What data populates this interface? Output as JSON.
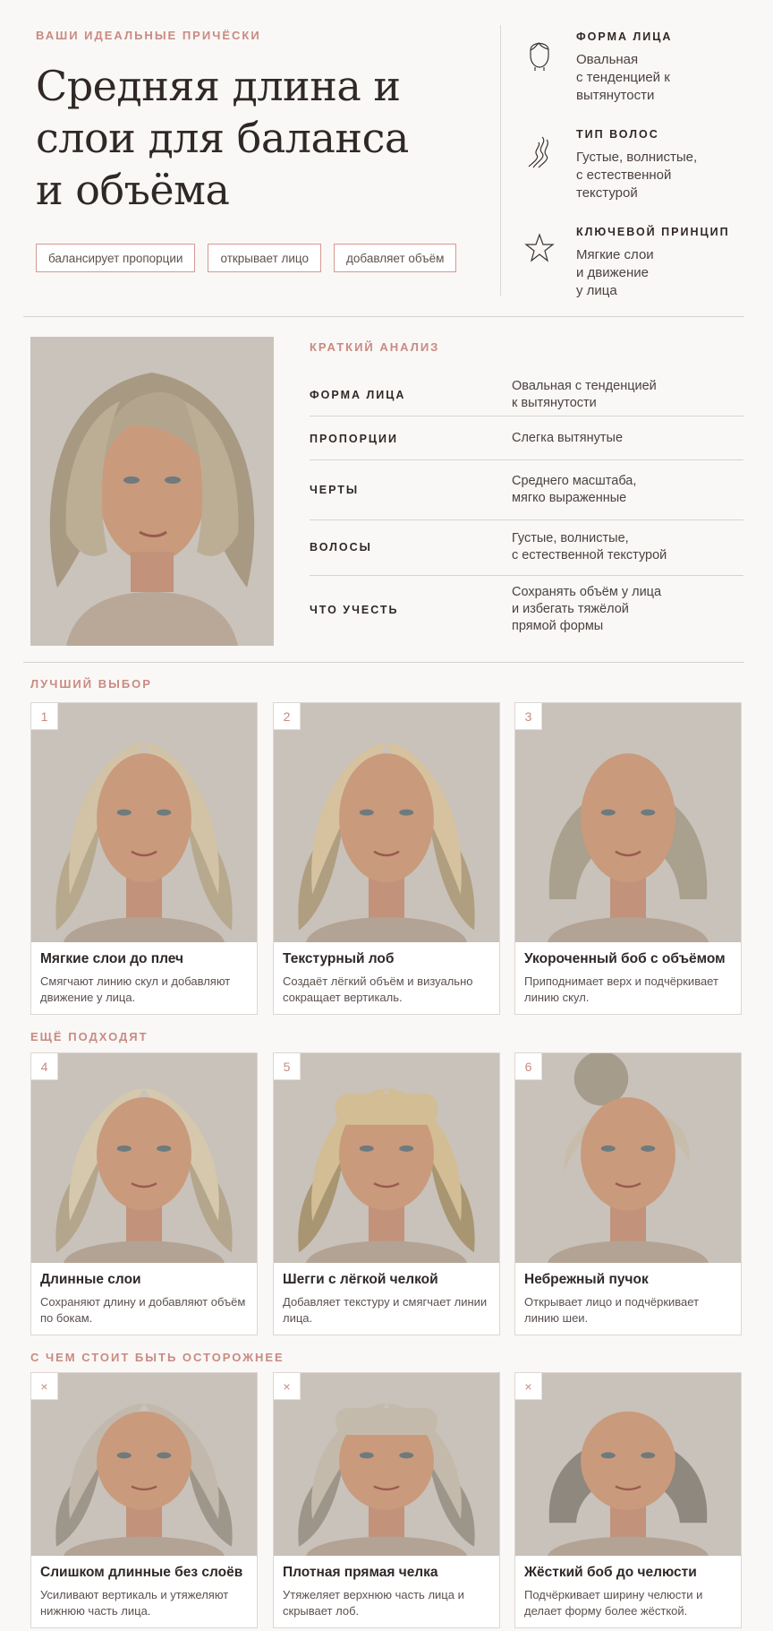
{
  "header": {
    "eyebrow": "ВАШИ ИДЕАЛЬНЫЕ ПРИЧЁСКИ",
    "title_lines": [
      "Средняя длина и",
      "слои для баланса",
      "и объёма"
    ],
    "tags": [
      "балансирует пропорции",
      "открывает лицо",
      "добавляет объём"
    ]
  },
  "facts": [
    {
      "icon": "face-outline-icon",
      "title": "ФОРМА ЛИЦА",
      "value": "Овальная\nс тенденцией к\nвытянутости"
    },
    {
      "icon": "hair-wave-icon",
      "title": "ТИП ВОЛОС",
      "value": "Густые, волнистые,\nс естественной\nтекстурой"
    },
    {
      "icon": "star-icon",
      "title": "КЛЮЧЕВОЙ ПРИНЦИП",
      "value": "Мягкие слои\nи движение\nу лица"
    }
  ],
  "analysis": {
    "eyebrow": "КРАТКИЙ АНАЛИЗ",
    "rows": [
      {
        "key": "ФОРМА ЛИЦА",
        "value": "Овальная с тенденцией\nк вытянутости"
      },
      {
        "key": "ПРОПОРЦИИ",
        "value": "Слегка вытянутые"
      },
      {
        "key": "ЧЕРТЫ",
        "value": "Среднего масштаба,\nмягко выраженные"
      },
      {
        "key": "ВОЛОСЫ",
        "value": "Густые, волнистые,\nс естественной текстурой"
      },
      {
        "key": "ЧТО УЧЕСТЬ",
        "value": "Сохранять объём у лица\nи избегать тяжёлой\nпрямой формы"
      }
    ]
  },
  "best": {
    "title": "ЛУЧШИЙ ВЫБОР",
    "cards": [
      {
        "num": "1",
        "title": "Мягкие слои до плеч",
        "desc": "Смягчают линию скул и добавляют движение у лица."
      },
      {
        "num": "2",
        "title": "Текстурный лоб",
        "desc": "Создаёт лёгкий объём и визуально сокращает вертикаль."
      },
      {
        "num": "3",
        "title": "Укороченный боб с объёмом",
        "desc": "Приподнимает верх и подчёркивает линию скул."
      }
    ]
  },
  "also": {
    "title": "ЕЩЁ ПОДХОДЯТ",
    "cards": [
      {
        "num": "4",
        "title": "Длинные слои",
        "desc": "Сохраняют длину и добавляют объём по бокам."
      },
      {
        "num": "5",
        "title": "Шегги с лёгкой челкой",
        "desc": "Добавляет текстуру и смягчает линии лица."
      },
      {
        "num": "6",
        "title": "Небрежный пучок",
        "desc": "Открывает лицо и подчёркивает линию шеи."
      }
    ]
  },
  "caution": {
    "title": "С ЧЕМ СТОИТ БЫТЬ ОСТОРОЖНЕЕ",
    "cards": [
      {
        "num": "×",
        "title": "Слишком длинные без слоёв",
        "desc": "Усиливают вертикаль и утяжеляют нижнюю часть лица."
      },
      {
        "num": "×",
        "title": "Плотная прямая челка",
        "desc": "Утяжеляет верхнюю часть лица и скрывает лоб."
      },
      {
        "num": "×",
        "title": "Жёсткий боб до челюсти",
        "desc": "Подчёркивает ширину челюсти и делает форму более жёсткой."
      }
    ]
  },
  "colors": {
    "accent": "#c98a82",
    "background": "#faf8f6",
    "text": "#2f2826"
  }
}
